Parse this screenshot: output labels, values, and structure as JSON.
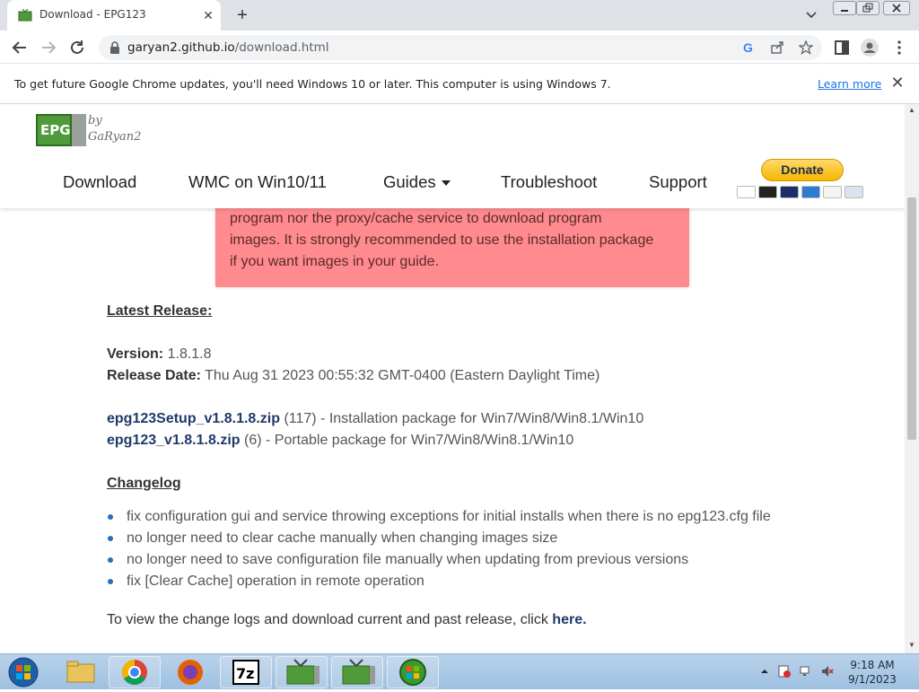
{
  "browser": {
    "tab_title": "Download - EPG123",
    "url_host": "garyan2.github.io",
    "url_path": "/download.html"
  },
  "infobar": {
    "message": "To get future Google Chrome updates, you'll need Windows 10 or later. This computer is using Windows 7.",
    "learn_more": "Learn more"
  },
  "site": {
    "logo_text": "EPG",
    "logo_by": "by",
    "logo_name": "GaRyan2",
    "nav": [
      "Download",
      "WMC on Win10/11",
      "Guides",
      "Troubleshoot",
      "Support"
    ],
    "donate_label": "Donate"
  },
  "content": {
    "alert_lines": [
      "program nor the proxy/cache service to download program",
      "images. It is strongly recommended to use the installation package",
      "if you want images in your guide."
    ],
    "latest_release_heading": "Latest Release:",
    "version_label": "Version:",
    "version_value": "1.8.1.8",
    "release_date_label": "Release Date:",
    "release_date_value": "Thu Aug 31 2023 00:55:32 GMT-0400 (Eastern Daylight Time)",
    "downloads": [
      {
        "file": "epg123Setup_v1.8.1.8.zip",
        "count": "(117)",
        "desc": " - Installation package for Win7/Win8/Win8.1/Win10"
      },
      {
        "file": "epg123_v1.8.1.8.zip",
        "count": "(6)",
        "desc": " - Portable package for Win7/Win8/Win8.1/Win10"
      }
    ],
    "changelog_heading": "Changelog",
    "changelog": [
      "fix configuration gui and service throwing exceptions for initial installs when there is no epg123.cfg file",
      "no longer need to clear cache manually when changing images size",
      "no longer need to save configuration file manually when updating from previous versions",
      "fix [Clear Cache] operation in remote operation"
    ],
    "footer_text": "To view the change logs and download current and past release, click ",
    "footer_link": "here."
  },
  "taskbar": {
    "time": "9:18 AM",
    "date": "9/1/2023"
  }
}
